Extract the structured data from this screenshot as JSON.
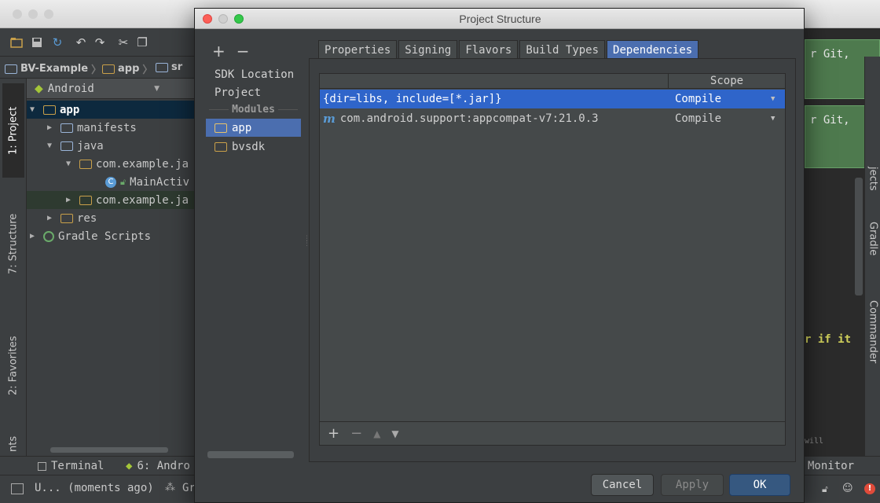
{
  "ide": {
    "breadcrumb": [
      "BV-Example",
      "app",
      "sr"
    ],
    "project_panel": {
      "view": "Android"
    },
    "tree": [
      {
        "label": "app",
        "depth": 0,
        "expanded": true
      },
      {
        "label": "manifests",
        "depth": 1,
        "expanded": false
      },
      {
        "label": "java",
        "depth": 1,
        "expanded": true
      },
      {
        "label": "com.example.ja",
        "depth": 2,
        "expanded": true
      },
      {
        "label": "MainActiv",
        "depth": 3
      },
      {
        "label": "com.example.ja",
        "depth": 2,
        "expanded": false
      },
      {
        "label": "res",
        "depth": 1,
        "expanded": false
      },
      {
        "label": "Gradle Scripts",
        "depth": 0,
        "expanded": false
      }
    ],
    "left_stripe": [
      "1: Project",
      "7: Structure",
      "2: Favorites",
      "nts"
    ],
    "right_stripe": [
      "jects",
      "Gradle",
      "Commander"
    ],
    "right_text": [
      "r Git,",
      "r Git,",
      "r if it",
      "will"
    ],
    "bottom_tabs": [
      "Terminal",
      "6: Andro"
    ],
    "bottom_right": "Monitor",
    "status_text": "U... (moments ago)",
    "status_extra": "Gr"
  },
  "dialog": {
    "title": "Project Structure",
    "nav": {
      "plus": "+",
      "minus": "−",
      "items": [
        "SDK Location",
        "Project"
      ],
      "section": "Modules",
      "modules": [
        "app",
        "bvsdk"
      ],
      "selected": "app"
    },
    "tabs": [
      "Properties",
      "Signing",
      "Flavors",
      "Build Types",
      "Dependencies"
    ],
    "active_tab": "Dependencies",
    "table": {
      "header_scope": "Scope",
      "rows": [
        {
          "dependency": "{dir=libs, include=[*.jar]}",
          "scope": "Compile",
          "selected": true,
          "icon": ""
        },
        {
          "dependency": "com.android.support:appcompat-v7:21.0.3",
          "scope": "Compile",
          "selected": false,
          "icon": "m"
        }
      ],
      "footer": {
        "add": "+",
        "remove": "−",
        "up": "▲",
        "down": "▼"
      }
    },
    "buttons": {
      "cancel": "Cancel",
      "apply": "Apply",
      "ok": "OK"
    }
  },
  "colors": {
    "accent": "#4b6eaf",
    "selection": "#2f65ca",
    "ok_button": "#365880"
  }
}
